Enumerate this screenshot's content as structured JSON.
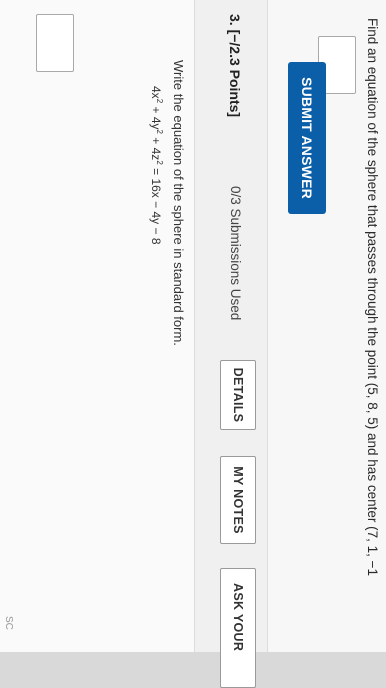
{
  "previous_question": {
    "text": "Find an equation of the sphere that passes through the point (5, 8, 5) and has center (7, 1, −1"
  },
  "submit_button": {
    "label": "SUBMIT ANSWER"
  },
  "question": {
    "number": "3.",
    "points": "[−/2.3 Points]",
    "submissions": "0/3 Submissions Used",
    "details_label": "DETAILS",
    "my_notes_label": "MY NOTES",
    "ask_label": "ASK YOUR",
    "prompt": "Write the equation of the sphere in standard form.",
    "equation": {
      "t1_coef": "4x",
      "exp": "2",
      "t2": " + 4y",
      "t3": " + 4z",
      "rhs": " = 16x − 4y − 8"
    }
  },
  "corner_text": "SC"
}
